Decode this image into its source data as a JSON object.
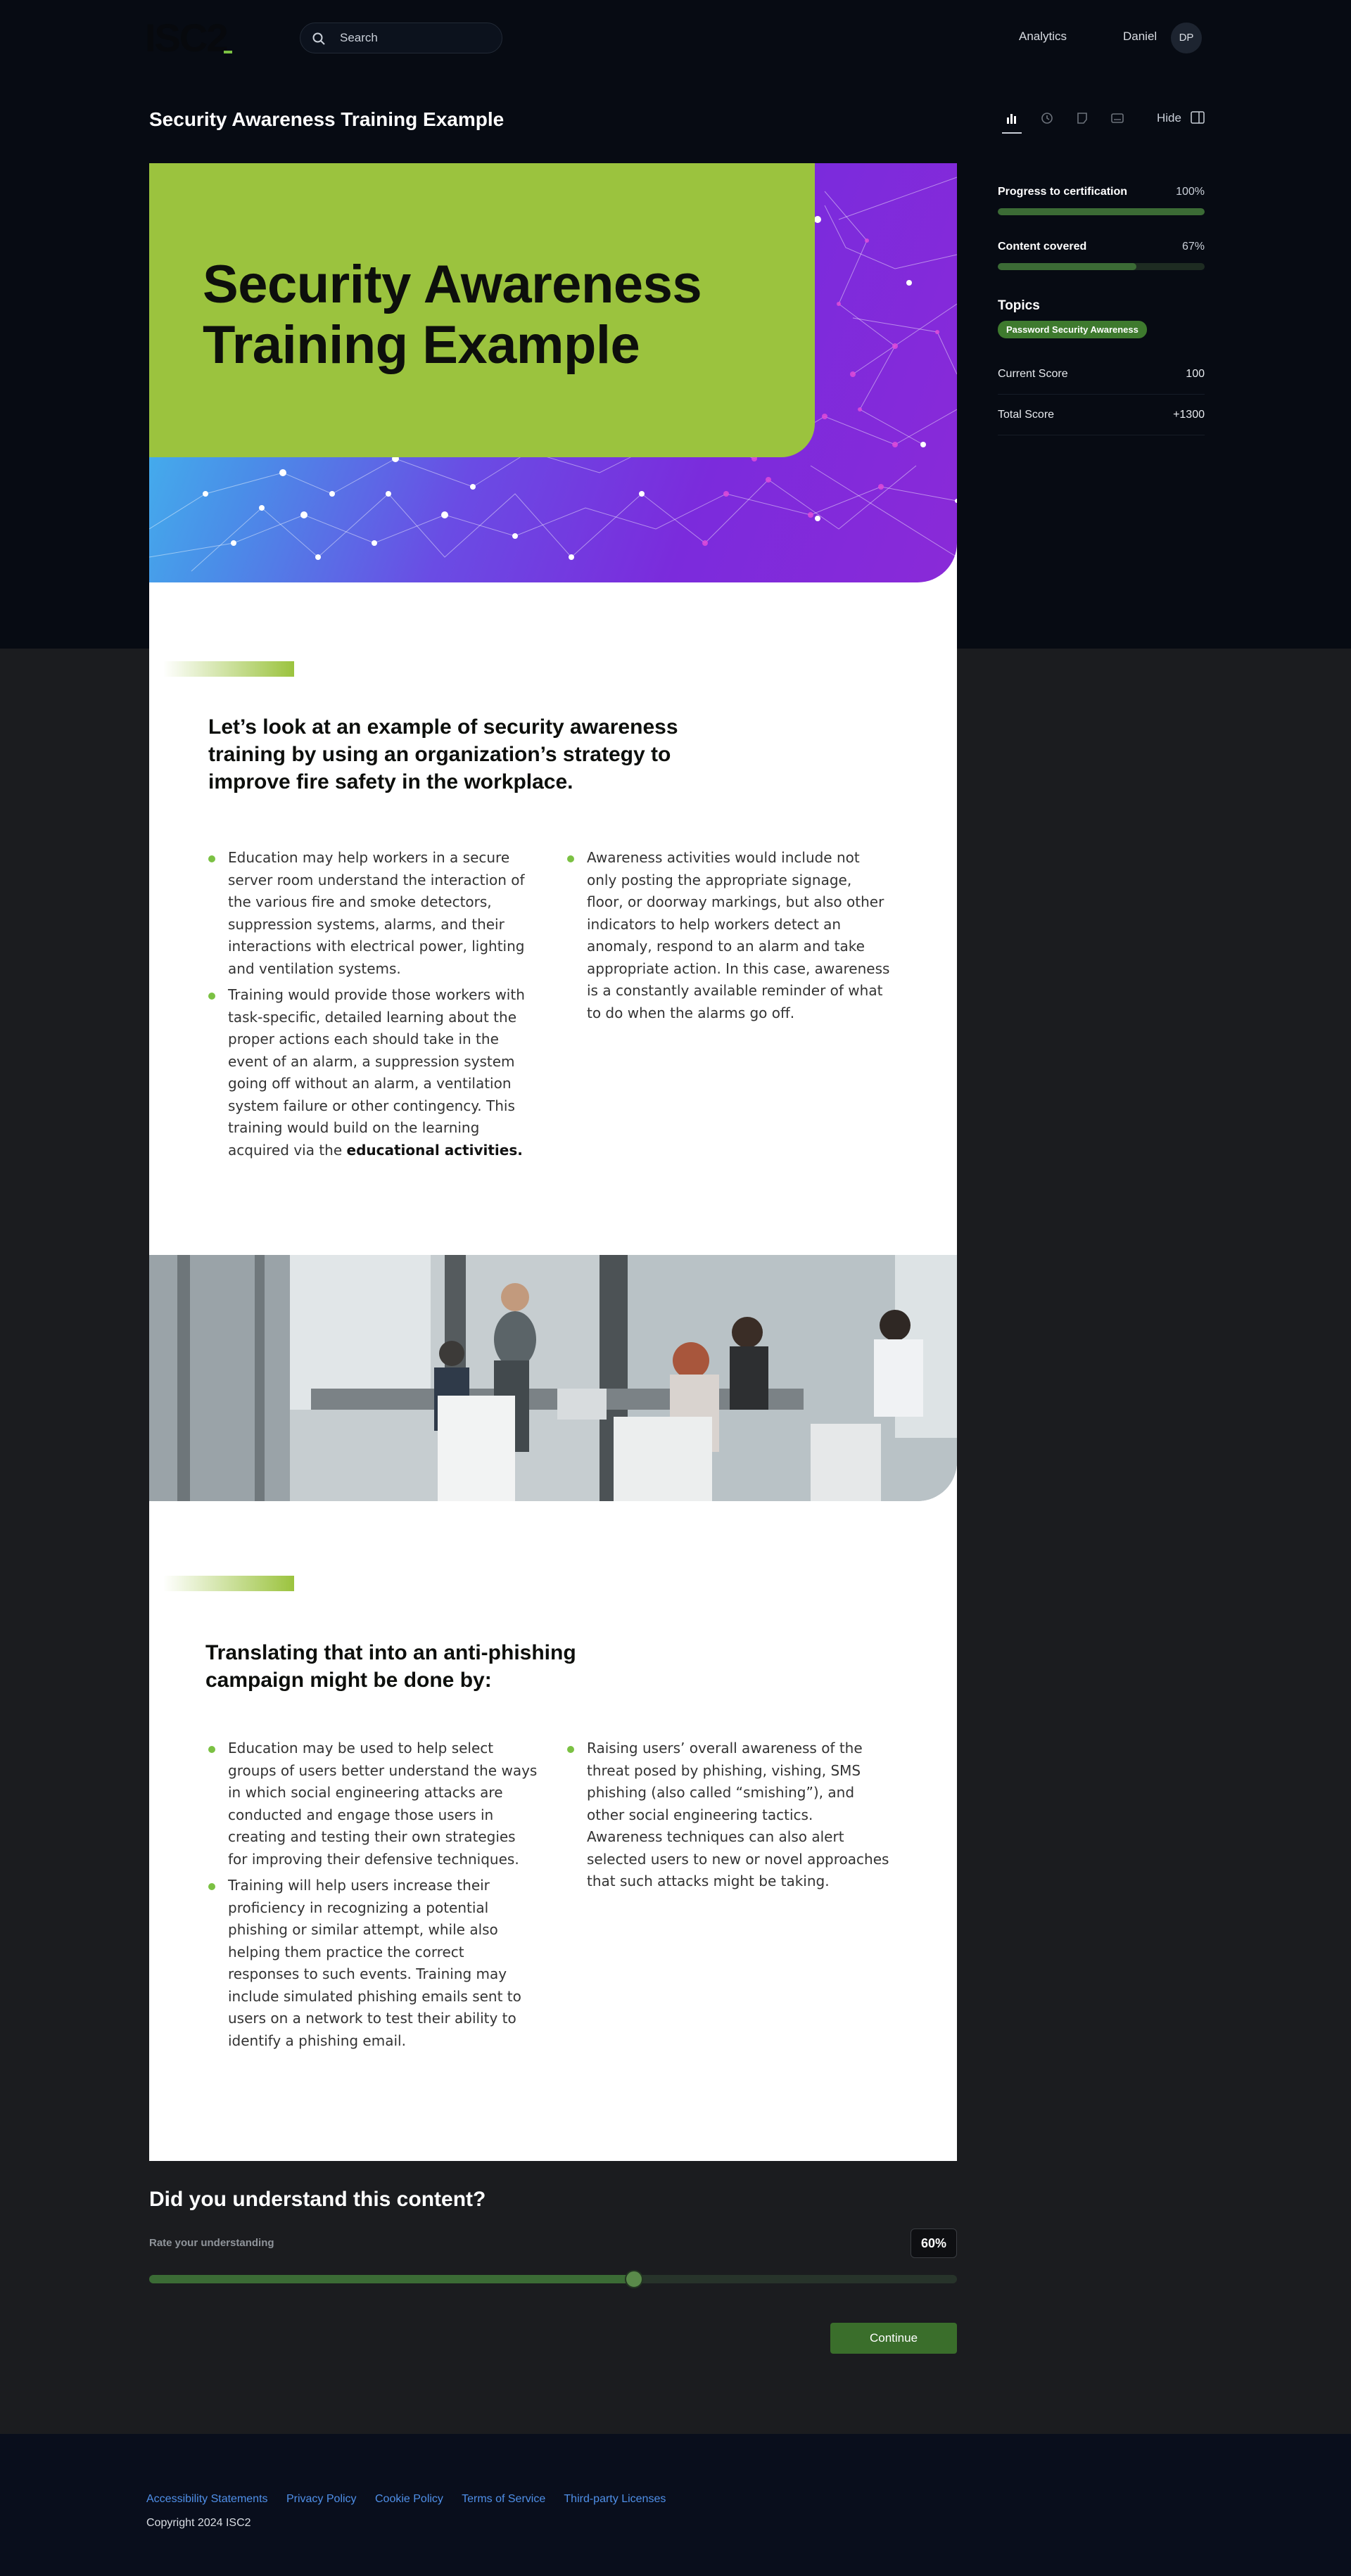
{
  "header": {
    "logo_text": "ISC2",
    "search_placeholder": "Search",
    "nav_analytics": "Analytics",
    "user_name": "Daniel",
    "avatar_initials": "DP"
  },
  "page": {
    "title": "Security Awareness Training Example",
    "hide_label": "Hide"
  },
  "sidebar": {
    "progress_label": "Progress to certification",
    "progress_value": "100%",
    "progress_fraction": 1.0,
    "content_label": "Content covered",
    "content_value": "67%",
    "content_fraction": 0.67,
    "topics_title": "Topics",
    "topic_chip": "Password Security Awareness",
    "current_score_label": "Current Score",
    "current_score_value": "100",
    "total_score_label": "Total Score",
    "total_score_value": "+1300"
  },
  "hero": {
    "title": "Security Awareness Training Example"
  },
  "section1": {
    "heading": "Let’s look at an example of security awareness training by using an organization’s strategy to improve fire safety in the workplace.",
    "left_bullets": [
      "Education may help workers in a secure server room understand the interaction of the various fire and smoke detectors, suppression systems, alarms, and their interactions with electrical power, lighting and ventilation systems.",
      "Training would provide those workers with task-specific, detailed learning about the proper actions each should take in the event of an alarm, a suppression system going off without an alarm, a ventilation system failure or other contingency. This training would build on the learning acquired via the"
    ],
    "left_bullet2_bold": "educational activities.",
    "right_bullets": [
      "Awareness activities would include not only posting the appropriate signage, floor, or doorway markings, but also other indicators to help workers detect an anomaly, respond to an alarm and take appropriate action. In this case, awareness is a constantly available reminder of what to do when the alarms go off."
    ]
  },
  "section2": {
    "heading": "Translating that into an anti-phishing campaign might be done by:",
    "left_bullets": [
      "Education may be used to help select groups of users better understand the ways in which social engineering attacks are conducted and engage those users in creating and testing their own strategies for improving their defensive techniques.",
      "Training will help users increase their proficiency in recognizing a potential phishing or similar attempt, while also helping them practice the correct responses to such events. Training may include simulated phishing emails sent to users on a network to test their ability to identify a phishing email."
    ],
    "right_bullets": [
      "Raising users’ overall awareness of the threat posed by phishing, vishing, SMS phishing (also called “smishing”), and other social engineering tactics. Awareness techniques can also alert selected users to new or novel approaches that such attacks might be taking."
    ]
  },
  "rating": {
    "title": "Did you understand this content?",
    "label": "Rate your understanding",
    "value_text": "60%",
    "fraction": 0.6,
    "continue_label": "Continue"
  },
  "footer": {
    "links": [
      "Accessibility Statements",
      "Privacy Policy",
      "Cookie Policy",
      "Terms of Service",
      "Third-party Licenses"
    ],
    "copyright": "Copyright 2024 ISC2"
  },
  "colors": {
    "accent_green": "#9bc33e",
    "button_green": "#3a6e2b",
    "link_blue": "#4f8fe8"
  }
}
